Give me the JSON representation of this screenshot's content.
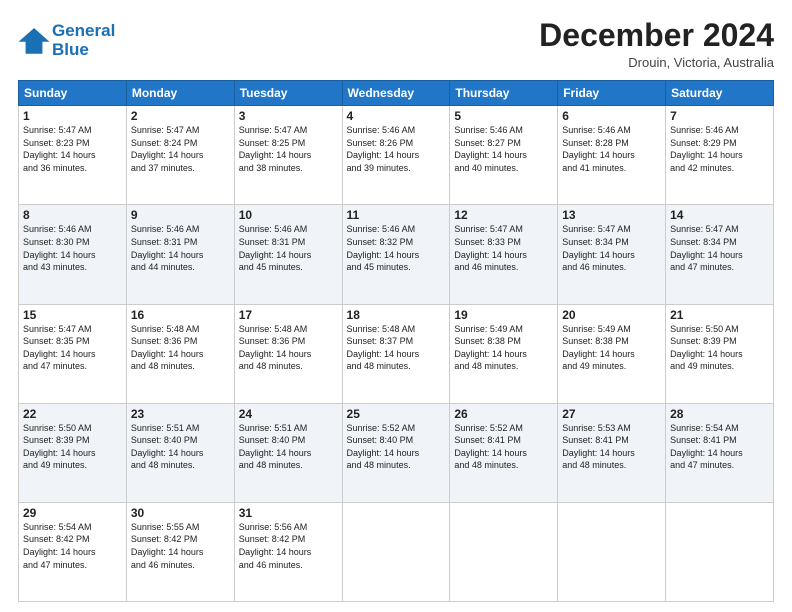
{
  "header": {
    "logo_line1": "General",
    "logo_line2": "Blue",
    "month": "December 2024",
    "location": "Drouin, Victoria, Australia"
  },
  "weekdays": [
    "Sunday",
    "Monday",
    "Tuesday",
    "Wednesday",
    "Thursday",
    "Friday",
    "Saturday"
  ],
  "weeks": [
    [
      {
        "day": "1",
        "info": "Sunrise: 5:47 AM\nSunset: 8:23 PM\nDaylight: 14 hours\nand 36 minutes."
      },
      {
        "day": "2",
        "info": "Sunrise: 5:47 AM\nSunset: 8:24 PM\nDaylight: 14 hours\nand 37 minutes."
      },
      {
        "day": "3",
        "info": "Sunrise: 5:47 AM\nSunset: 8:25 PM\nDaylight: 14 hours\nand 38 minutes."
      },
      {
        "day": "4",
        "info": "Sunrise: 5:46 AM\nSunset: 8:26 PM\nDaylight: 14 hours\nand 39 minutes."
      },
      {
        "day": "5",
        "info": "Sunrise: 5:46 AM\nSunset: 8:27 PM\nDaylight: 14 hours\nand 40 minutes."
      },
      {
        "day": "6",
        "info": "Sunrise: 5:46 AM\nSunset: 8:28 PM\nDaylight: 14 hours\nand 41 minutes."
      },
      {
        "day": "7",
        "info": "Sunrise: 5:46 AM\nSunset: 8:29 PM\nDaylight: 14 hours\nand 42 minutes."
      }
    ],
    [
      {
        "day": "8",
        "info": "Sunrise: 5:46 AM\nSunset: 8:30 PM\nDaylight: 14 hours\nand 43 minutes."
      },
      {
        "day": "9",
        "info": "Sunrise: 5:46 AM\nSunset: 8:31 PM\nDaylight: 14 hours\nand 44 minutes."
      },
      {
        "day": "10",
        "info": "Sunrise: 5:46 AM\nSunset: 8:31 PM\nDaylight: 14 hours\nand 45 minutes."
      },
      {
        "day": "11",
        "info": "Sunrise: 5:46 AM\nSunset: 8:32 PM\nDaylight: 14 hours\nand 45 minutes."
      },
      {
        "day": "12",
        "info": "Sunrise: 5:47 AM\nSunset: 8:33 PM\nDaylight: 14 hours\nand 46 minutes."
      },
      {
        "day": "13",
        "info": "Sunrise: 5:47 AM\nSunset: 8:34 PM\nDaylight: 14 hours\nand 46 minutes."
      },
      {
        "day": "14",
        "info": "Sunrise: 5:47 AM\nSunset: 8:34 PM\nDaylight: 14 hours\nand 47 minutes."
      }
    ],
    [
      {
        "day": "15",
        "info": "Sunrise: 5:47 AM\nSunset: 8:35 PM\nDaylight: 14 hours\nand 47 minutes."
      },
      {
        "day": "16",
        "info": "Sunrise: 5:48 AM\nSunset: 8:36 PM\nDaylight: 14 hours\nand 48 minutes."
      },
      {
        "day": "17",
        "info": "Sunrise: 5:48 AM\nSunset: 8:36 PM\nDaylight: 14 hours\nand 48 minutes."
      },
      {
        "day": "18",
        "info": "Sunrise: 5:48 AM\nSunset: 8:37 PM\nDaylight: 14 hours\nand 48 minutes."
      },
      {
        "day": "19",
        "info": "Sunrise: 5:49 AM\nSunset: 8:38 PM\nDaylight: 14 hours\nand 48 minutes."
      },
      {
        "day": "20",
        "info": "Sunrise: 5:49 AM\nSunset: 8:38 PM\nDaylight: 14 hours\nand 49 minutes."
      },
      {
        "day": "21",
        "info": "Sunrise: 5:50 AM\nSunset: 8:39 PM\nDaylight: 14 hours\nand 49 minutes."
      }
    ],
    [
      {
        "day": "22",
        "info": "Sunrise: 5:50 AM\nSunset: 8:39 PM\nDaylight: 14 hours\nand 49 minutes."
      },
      {
        "day": "23",
        "info": "Sunrise: 5:51 AM\nSunset: 8:40 PM\nDaylight: 14 hours\nand 48 minutes."
      },
      {
        "day": "24",
        "info": "Sunrise: 5:51 AM\nSunset: 8:40 PM\nDaylight: 14 hours\nand 48 minutes."
      },
      {
        "day": "25",
        "info": "Sunrise: 5:52 AM\nSunset: 8:40 PM\nDaylight: 14 hours\nand 48 minutes."
      },
      {
        "day": "26",
        "info": "Sunrise: 5:52 AM\nSunset: 8:41 PM\nDaylight: 14 hours\nand 48 minutes."
      },
      {
        "day": "27",
        "info": "Sunrise: 5:53 AM\nSunset: 8:41 PM\nDaylight: 14 hours\nand 48 minutes."
      },
      {
        "day": "28",
        "info": "Sunrise: 5:54 AM\nSunset: 8:41 PM\nDaylight: 14 hours\nand 47 minutes."
      }
    ],
    [
      {
        "day": "29",
        "info": "Sunrise: 5:54 AM\nSunset: 8:42 PM\nDaylight: 14 hours\nand 47 minutes."
      },
      {
        "day": "30",
        "info": "Sunrise: 5:55 AM\nSunset: 8:42 PM\nDaylight: 14 hours\nand 46 minutes."
      },
      {
        "day": "31",
        "info": "Sunrise: 5:56 AM\nSunset: 8:42 PM\nDaylight: 14 hours\nand 46 minutes."
      },
      null,
      null,
      null,
      null
    ]
  ]
}
